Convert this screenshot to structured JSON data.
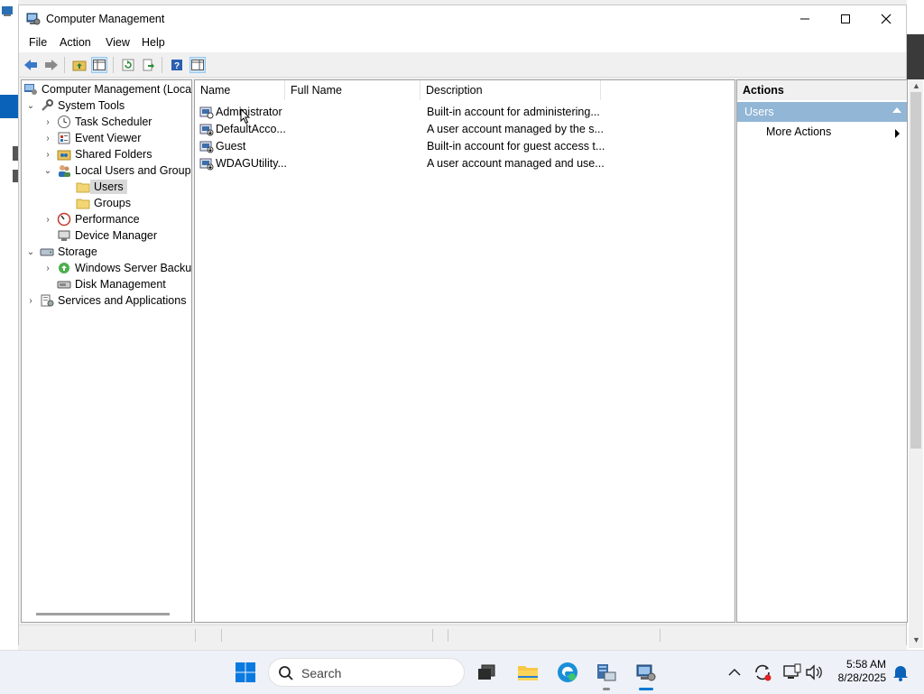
{
  "window": {
    "title": "Computer Management",
    "controls": [
      "minimize",
      "maximize",
      "close"
    ]
  },
  "menu": [
    "File",
    "Action",
    "View",
    "Help"
  ],
  "tree": {
    "root": "Computer Management (Local",
    "system_tools": "System Tools",
    "task_scheduler": "Task Scheduler",
    "event_viewer": "Event Viewer",
    "shared_folders": "Shared Folders",
    "local_users_groups": "Local Users and Groups",
    "users": "Users",
    "groups": "Groups",
    "performance": "Performance",
    "device_manager": "Device Manager",
    "storage": "Storage",
    "windows_server_backup": "Windows Server Backup",
    "disk_management": "Disk Management",
    "services_apps": "Services and Applications"
  },
  "list": {
    "columns": [
      "Name",
      "Full Name",
      "Description"
    ],
    "rows": [
      {
        "name": "Administrator",
        "full_name": "",
        "description": "Built-in account for administering..."
      },
      {
        "name": "DefaultAcco...",
        "full_name": "",
        "description": "A user account managed by the s..."
      },
      {
        "name": "Guest",
        "full_name": "",
        "description": "Built-in account for guest access t..."
      },
      {
        "name": "WDAGUtility...",
        "full_name": "",
        "description": "A user account managed and use..."
      }
    ]
  },
  "actions": {
    "header": "Actions",
    "section": "Users",
    "more_actions": "More Actions"
  },
  "taskbar": {
    "search_placeholder": "Search",
    "time": "5:58 AM",
    "date": "8/28/2025"
  },
  "colors": {
    "accent": "#0078d4",
    "selected_section": "#92b6d6"
  }
}
